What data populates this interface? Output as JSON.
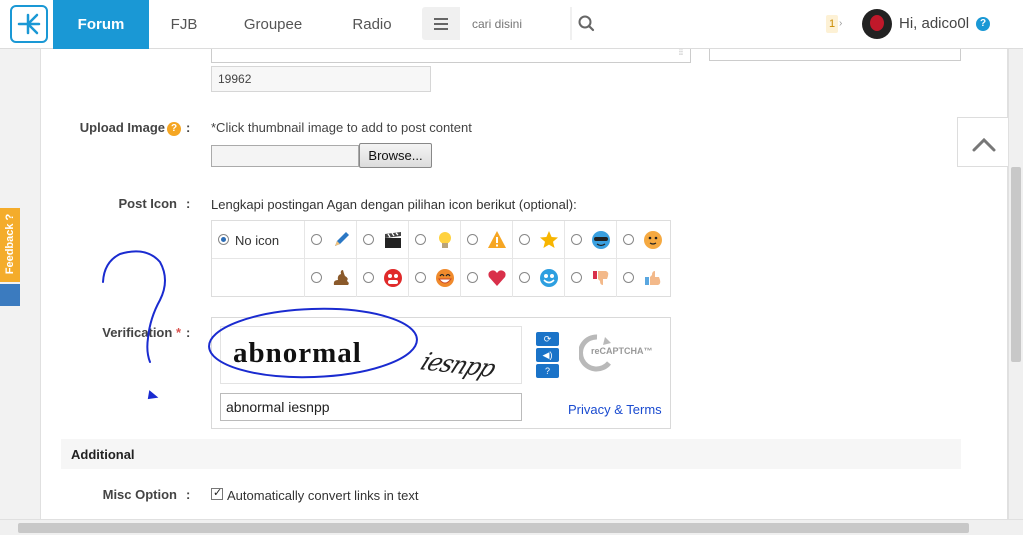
{
  "nav": {
    "tabs": [
      {
        "label": "Forum",
        "active": true
      },
      {
        "label": "FJB"
      },
      {
        "label": "Groupee"
      },
      {
        "label": "Radio"
      }
    ],
    "search_placeholder": "cari disini",
    "notification_count": "1",
    "greeting": "Hi, adico0l",
    "accent_color": "#1a98d5"
  },
  "form": {
    "number_value": "19962",
    "upload": {
      "label": "Upload Image",
      "hint": "*Click thumbnail image to add to post content",
      "browse_label": "Browse..."
    },
    "post_icon": {
      "label": "Post Icon",
      "hint": "Lengkapi postingan Agan dengan pilihan icon berikut (optional):",
      "no_icon_label": "No icon",
      "icons_row1": [
        "pencil-icon",
        "clapper-icon",
        "bulb-icon",
        "warning-icon",
        "star-icon",
        "cool-face-icon",
        "blush-face-icon"
      ],
      "icons_row2": [
        "poop-icon",
        "angry-face-icon",
        "laugh-face-icon",
        "heart-icon",
        "smile-face-icon",
        "thumbs-down-icon",
        "thumbs-up-icon"
      ]
    },
    "verification": {
      "label": "Verification",
      "required_mark": "*",
      "captcha_word1": "abnormal",
      "captcha_word2": "iesnpp",
      "answer": "abnormal iesnpp",
      "privacy_link": "Privacy & Terms",
      "recaptcha_label": "reCAPTCHA™"
    },
    "additional_heading": "Additional",
    "misc": {
      "label": "Misc Option",
      "checkbox_label": "Automatically convert links in text",
      "checked": true
    }
  },
  "side": {
    "feedback_label": "Feedback ?"
  },
  "colon": ":"
}
